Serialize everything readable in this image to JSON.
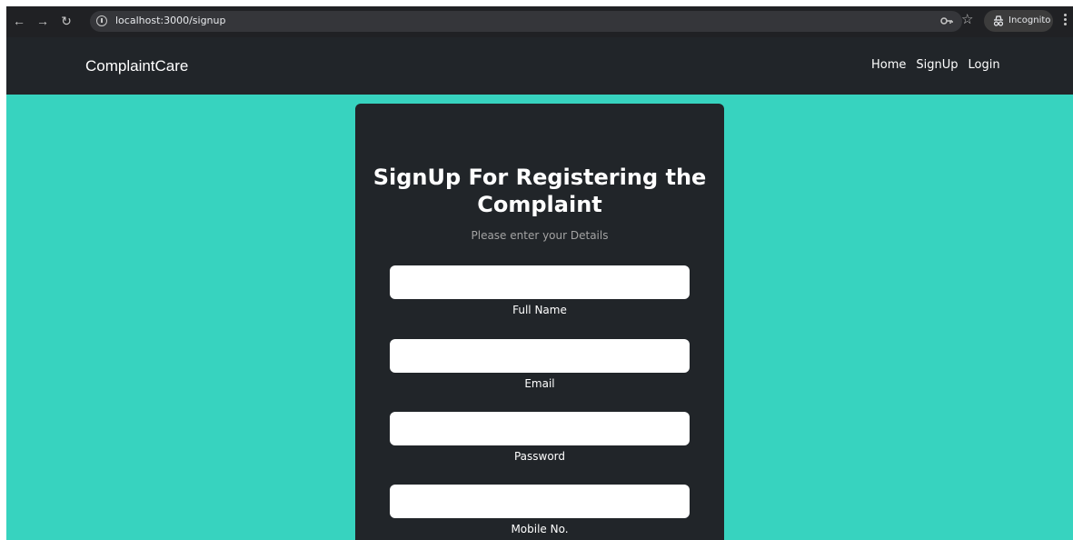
{
  "browser": {
    "url": "localhost:3000/signup",
    "incognito_label": "Incognito",
    "icons": [
      "back-icon",
      "forward-icon",
      "reload-icon",
      "info-icon",
      "key-icon",
      "star-icon",
      "incognito-icon",
      "menu-icon"
    ]
  },
  "navbar": {
    "brand": "ComplaintCare",
    "links": [
      "Home",
      "SignUp",
      "Login"
    ]
  },
  "form": {
    "title": "SignUp For Registering the Complaint",
    "subtitle": "Please enter your Details",
    "fields": [
      {
        "label": "Full Name",
        "value": ""
      },
      {
        "label": "Email",
        "value": ""
      },
      {
        "label": "Password",
        "value": ""
      },
      {
        "label": "Mobile No.",
        "value": ""
      }
    ]
  },
  "colors": {
    "page_background": "#37d3bf",
    "navbar": "#212529",
    "card": "#212529"
  }
}
